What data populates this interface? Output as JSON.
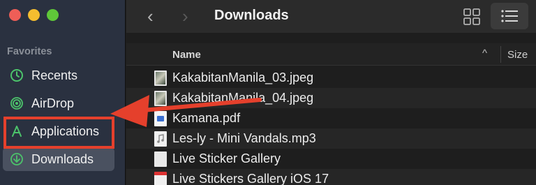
{
  "sidebar": {
    "section_title": "Favorites",
    "items": [
      {
        "label": "Recents",
        "icon": "clock-icon"
      },
      {
        "label": "AirDrop",
        "icon": "airdrop-icon"
      },
      {
        "label": "Applications",
        "icon": "applications-icon"
      },
      {
        "label": "Downloads",
        "icon": "downloads-icon"
      }
    ]
  },
  "toolbar": {
    "back": "‹",
    "forward": "›",
    "title": "Downloads"
  },
  "columns": {
    "name": "Name",
    "sort_indicator": "^",
    "size": "Size"
  },
  "files": [
    {
      "name": "KakabitanManila_03.jpeg",
      "icon": "image-file-icon"
    },
    {
      "name": "KakabitanManila_04.jpeg",
      "icon": "image-file-icon"
    },
    {
      "name": "Kamana.pdf",
      "icon": "pdf-file-icon"
    },
    {
      "name": "Les-ly - Mini Vandals.mp3",
      "icon": "audio-file-icon"
    },
    {
      "name": "Live Sticker Gallery",
      "icon": "folder-icon"
    },
    {
      "name": "Live Stickers Gallery iOS 17",
      "icon": "document-icon"
    }
  ],
  "colors": {
    "annotation_red": "#e5402c",
    "sidebar_bg": "#2a3140",
    "accent_green": "#4cc36b"
  }
}
